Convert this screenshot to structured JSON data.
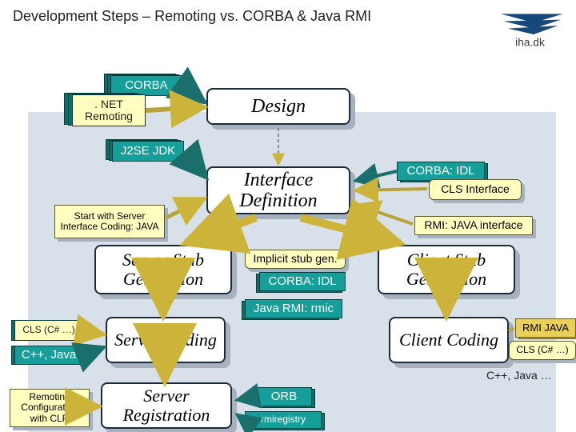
{
  "title": "Development Steps – Remoting vs. CORBA & Java RMI",
  "logo_text": "iha.dk",
  "tags": {
    "corba": "CORBA",
    "netremoting": ". NET Remoting",
    "j2se": "J2SE JDK",
    "cls1": "CLS (C# …)",
    "cppjava": "C++, Java",
    "remotingcfg": "Remoting Configuration with CLR"
  },
  "main": {
    "design": "Design",
    "ifdef": "Interface Definition",
    "serverstub": "Server Stub Generation",
    "clientstub": "Client Stub Generation",
    "servercoding": "Server Coding",
    "clientcoding": "Client Coding",
    "serverreg": "Server Registration"
  },
  "notes": {
    "startwith": "Start with Server Interface Coding: JAVA",
    "corbaidl": "CORBA: IDL",
    "clsif": "CLS Interface",
    "rmijavaif": "RMI: JAVA interface",
    "implicit": "Implicit stub gen.",
    "corbaidl2": "CORBA: IDL",
    "javarmic": "Java RMI: rmic",
    "orb": "ORB",
    "rmiregistry": "rmiregistry",
    "rmijava": "RMI JAVA",
    "cls2": "CLS (C# …)",
    "cppjava2": "C++, Java …"
  }
}
